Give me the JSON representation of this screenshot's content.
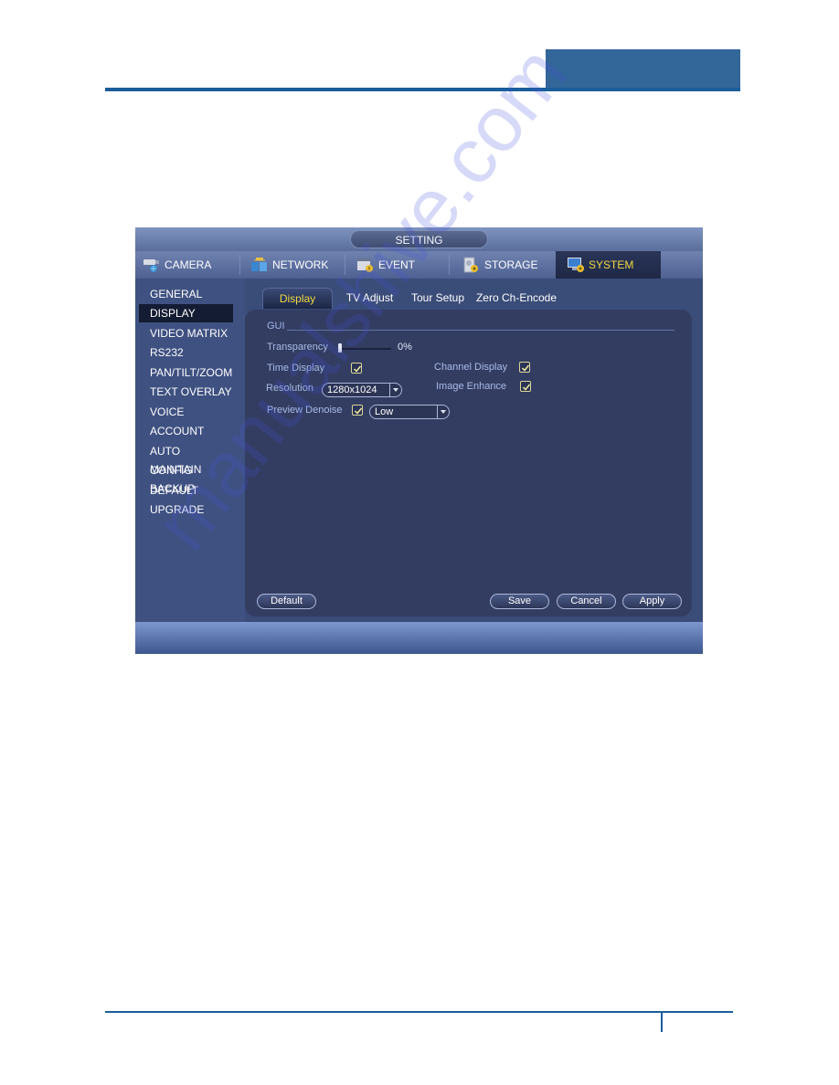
{
  "document": {
    "watermark": "manualshive.com"
  },
  "window": {
    "title": "SETTING"
  },
  "main_tabs": [
    {
      "label": "CAMERA",
      "icon": "camera-icon",
      "active": false
    },
    {
      "label": "NETWORK",
      "icon": "network-icon",
      "active": false
    },
    {
      "label": "EVENT",
      "icon": "event-icon",
      "active": false
    },
    {
      "label": "STORAGE",
      "icon": "storage-icon",
      "active": false
    },
    {
      "label": "SYSTEM",
      "icon": "system-icon",
      "active": true
    }
  ],
  "sidebar": {
    "items": [
      {
        "label": "GENERAL",
        "active": false
      },
      {
        "label": "DISPLAY",
        "active": true
      },
      {
        "label": "VIDEO MATRIX",
        "active": false
      },
      {
        "label": "RS232",
        "active": false
      },
      {
        "label": "PAN/TILT/ZOOM",
        "active": false
      },
      {
        "label": "TEXT OVERLAY",
        "active": false
      },
      {
        "label": "VOICE",
        "active": false
      },
      {
        "label": "ACCOUNT",
        "active": false
      },
      {
        "label": "AUTO MAINTAIN",
        "active": false
      },
      {
        "label": "CONFIG BACKUP",
        "active": false
      },
      {
        "label": "DEFAULT",
        "active": false
      },
      {
        "label": "UPGRADE",
        "active": false
      }
    ]
  },
  "sub_tabs": [
    {
      "label": "Display",
      "active": true
    },
    {
      "label": "TV Adjust",
      "active": false
    },
    {
      "label": "Tour Setup",
      "active": false
    },
    {
      "label": "Zero Ch-Encode",
      "active": false
    }
  ],
  "gui": {
    "section_label": "GUI",
    "transparency": {
      "label": "Transparency",
      "value_text": "0%",
      "value_percent": 0
    },
    "time_display": {
      "label": "Time Display",
      "checked": true
    },
    "channel_display": {
      "label": "Channel Display",
      "checked": true
    },
    "resolution": {
      "label": "Resolution",
      "value": "1280x1024"
    },
    "image_enhance": {
      "label": "Image Enhance",
      "checked": true
    },
    "preview_denoise": {
      "label": "Preview Denoise",
      "checked": true,
      "level": "Low"
    }
  },
  "buttons": {
    "default": "Default",
    "save": "Save",
    "cancel": "Cancel",
    "apply": "Apply"
  },
  "colors": {
    "accent_active_text": "#f0d844",
    "header_blue": "#336699"
  }
}
